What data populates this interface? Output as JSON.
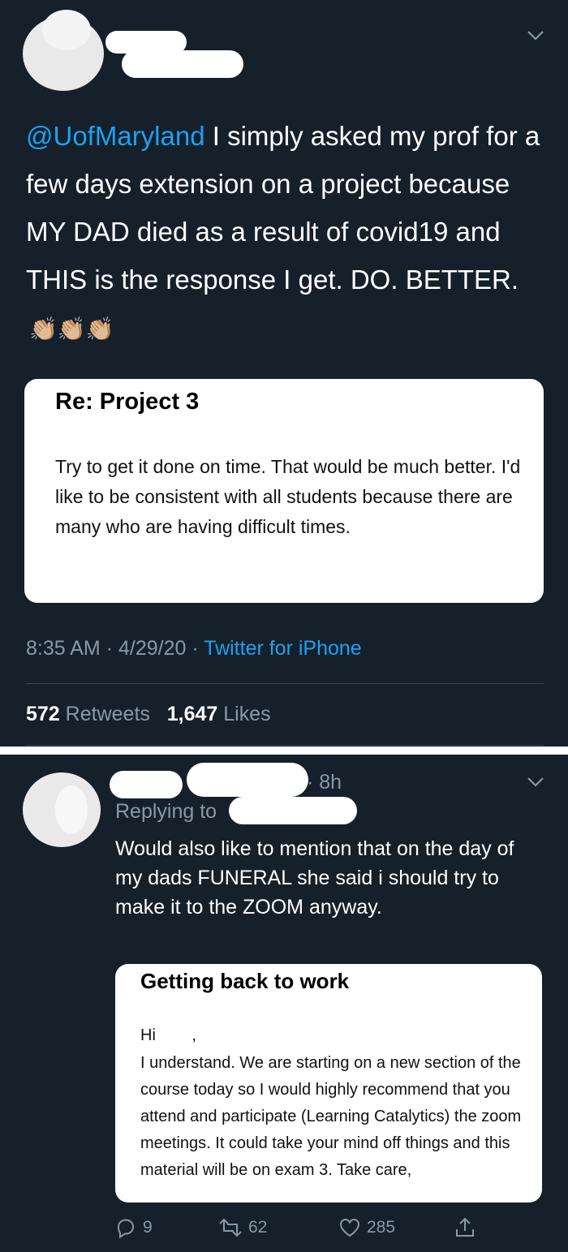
{
  "tweet": {
    "mention": "@UofMaryland",
    "text": " I simply asked my prof for a few days extension on a project because MY DAD died as a result of covid19 and THIS is the response I get. DO. BETTER.",
    "emoji": "👏🏼👏🏼👏🏼",
    "email_card": {
      "subject": "Re:  Project 3",
      "body": "Try to get it done on time.  That would be much better.  I'd like to be consistent with all students because there are many who are having difficult times."
    },
    "time": "8:35 AM",
    "date": "4/29/20",
    "source": "Twitter for iPhone",
    "retweets_count": "572",
    "retweets_label": "Retweets",
    "likes_count": "1,647",
    "likes_label": "Likes",
    "icons": [
      "chevron-down-icon"
    ]
  },
  "reply": {
    "age": "8h",
    "replying_to_label": "Replying to",
    "text": "Would also like to mention that on the day of my dads FUNERAL she said i should try to make it to the ZOOM anyway.",
    "email_card": {
      "subject": "Getting back to work",
      "greeting": "Hi        ,",
      "body": "I understand.  We are starting on a new section of the course today so I would highly recommend that you attend and participate (Learning Catalytics) the zoom meetings.  It could take your mind off things and this material will be on exam 3.  Take care,"
    },
    "actions": {
      "reply_count": "9",
      "retweet_count": "62",
      "like_count": "285"
    },
    "icons": [
      "reply-icon",
      "retweet-icon",
      "heart-icon",
      "share-icon",
      "chevron-down-icon"
    ]
  },
  "colors": {
    "background": "#15202b",
    "accent": "#1da1f2",
    "muted": "#8899a6",
    "divider": "#38444d"
  }
}
